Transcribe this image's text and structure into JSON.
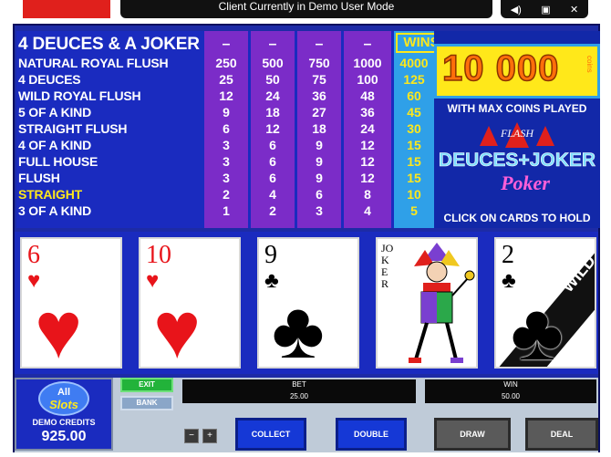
{
  "top": {
    "message": "Client Currently in Demo User Mode"
  },
  "paytable": {
    "title": "4 DEUCES & A JOKER",
    "wins_label": "WINS",
    "coin_headers": [
      "–",
      "–",
      "–",
      "–"
    ],
    "rows": [
      {
        "name": "NATURAL ROYAL FLUSH",
        "values": [
          "250",
          "500",
          "750",
          "1000"
        ],
        "win": "4000"
      },
      {
        "name": "4 DEUCES",
        "values": [
          "25",
          "50",
          "75",
          "100"
        ],
        "win": "125"
      },
      {
        "name": "WILD ROYAL FLUSH",
        "values": [
          "12",
          "24",
          "36",
          "48"
        ],
        "win": "60"
      },
      {
        "name": "5 OF A KIND",
        "values": [
          "9",
          "18",
          "27",
          "36"
        ],
        "win": "45"
      },
      {
        "name": "STRAIGHT FLUSH",
        "values": [
          "6",
          "12",
          "18",
          "24"
        ],
        "win": "30"
      },
      {
        "name": "4 OF A KIND",
        "values": [
          "3",
          "6",
          "9",
          "12"
        ],
        "win": "15"
      },
      {
        "name": "FULL HOUSE",
        "values": [
          "3",
          "6",
          "9",
          "12"
        ],
        "win": "15"
      },
      {
        "name": "FLUSH",
        "values": [
          "3",
          "6",
          "9",
          "12"
        ],
        "win": "15"
      },
      {
        "name": "STRAIGHT",
        "values": [
          "2",
          "4",
          "6",
          "8"
        ],
        "win": "10",
        "highlight": true
      },
      {
        "name": "3 OF A KIND",
        "values": [
          "1",
          "2",
          "3",
          "4"
        ],
        "win": "5"
      }
    ]
  },
  "promo": {
    "jackpot": "10 000",
    "jackpot_unit": "coins",
    "max_coins_text": "WITH MAX COINS PLAYED",
    "logo_flash": "FLASH",
    "logo_title": "DEUCES+JOKER",
    "logo_sub": "Poker",
    "click_text": "CLICK ON CARDS TO HOLD"
  },
  "cards": [
    {
      "rank": "6",
      "suit": "♥",
      "color": "red"
    },
    {
      "rank": "10",
      "suit": "♥",
      "color": "red"
    },
    {
      "rank": "9",
      "suit": "♣",
      "color": "black"
    },
    {
      "rank": "JOKER",
      "suit": "",
      "color": "black",
      "joker": true
    },
    {
      "rank": "2",
      "suit": "♣",
      "color": "black",
      "wild": "WILD"
    }
  ],
  "bottom": {
    "logo_line1": "All",
    "logo_line2": "Slots",
    "credits_label": "DEMO CREDITS",
    "credits_value": "925.00",
    "exit_label": "EXIT",
    "bank_label": "BANK",
    "bet_label": "BET",
    "bet_value": "25.00",
    "win_label": "WIN",
    "win_value": "50.00",
    "minus": "−",
    "plus": "+",
    "collect": "COLLECT",
    "double": "DOUBLE",
    "draw": "DRAW",
    "deal": "DEAL"
  }
}
